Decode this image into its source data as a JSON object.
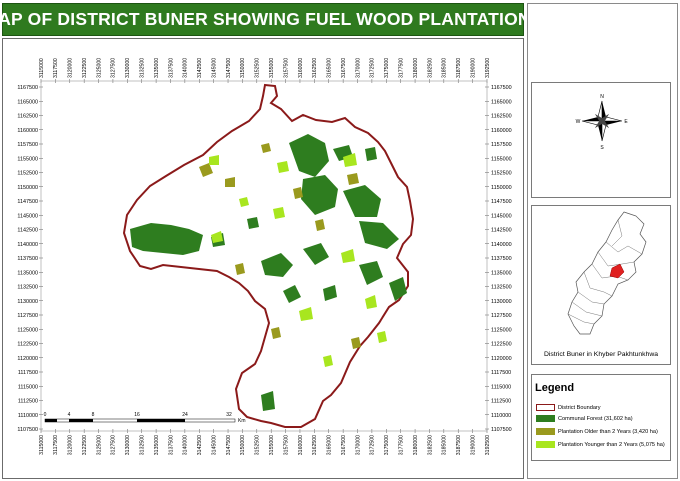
{
  "title": "MAP OF DISTRICT BUNER SHOWING FUEL WOOD PLANTATIONS",
  "easting_ticks": [
    "3115000",
    "3117500",
    "3120000",
    "3122500",
    "3125000",
    "3127500",
    "3130000",
    "3132500",
    "3135000",
    "3137500",
    "3140000",
    "3142500",
    "3145000",
    "3147500",
    "3150000",
    "3152500",
    "3155000",
    "3157500",
    "3160000",
    "3162500",
    "3165000",
    "3167500",
    "3170000",
    "3172500",
    "3175000",
    "3177500",
    "3180000",
    "3182500",
    "3185000",
    "3187500",
    "3190000",
    "3192500"
  ],
  "northing_ticks": [
    "1167500",
    "1165000",
    "1162500",
    "1160000",
    "1157500",
    "1155000",
    "1152500",
    "1150000",
    "1147500",
    "1145000",
    "1142500",
    "1140000",
    "1137500",
    "1135000",
    "1132500",
    "1130000",
    "1127500",
    "1125000",
    "1122500",
    "1120000",
    "1117500",
    "1115000",
    "1112500",
    "1110000",
    "1107500"
  ],
  "scale_bar": {
    "labels": [
      "0",
      "4",
      "8",
      "16",
      "24",
      "32"
    ],
    "unit": "Km"
  },
  "north_arrow": {
    "n": "N",
    "s": "S",
    "e": "E",
    "w": "W"
  },
  "locator_caption": "District Buner in Khyber Pakhtunkhwa",
  "legend": {
    "title": "Legend",
    "items": [
      {
        "label": "District Boundary",
        "color": "#ffffff",
        "border": "#8b1a1a"
      },
      {
        "label": "Communal Forest (31,602 ha)",
        "color": "#2e7d1f"
      },
      {
        "label": "Plantation Older than 2 Years (3,420 ha)",
        "color": "#9a9a1e"
      },
      {
        "label": "Plantation Younger than 2 Years (5,075 ha)",
        "color": "#a8e61f"
      }
    ]
  },
  "colors": {
    "boundary": "#8b1a1a",
    "forest": "#2e7d1f",
    "older": "#9a9a1e",
    "younger": "#a8e61f",
    "banner": "#2f7a1f",
    "highlight": "#e02020"
  }
}
